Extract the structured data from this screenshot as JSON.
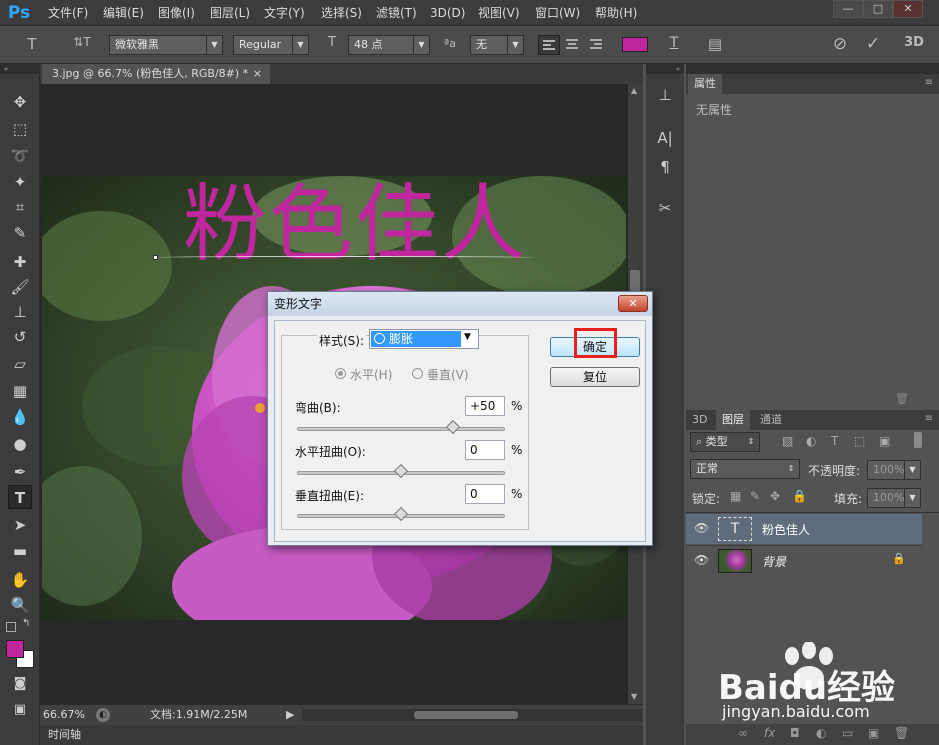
{
  "app": {
    "logo": "Ps",
    "accent": "#31a8ff"
  },
  "menu": [
    "文件(F)",
    "编辑(E)",
    "图像(I)",
    "图层(L)",
    "文字(Y)",
    "选择(S)",
    "滤镜(T)",
    "3D(D)",
    "视图(V)",
    "窗口(W)",
    "帮助(H)"
  ],
  "window_buttons": {
    "minimize": "—",
    "maximize": "□",
    "close": "✕"
  },
  "options": {
    "font_family": "微软雅黑",
    "font_style": "Regular",
    "font_size": "48 点",
    "antialias_label": "ªa",
    "antialias": "无",
    "text_color": "#c0279e",
    "icons": {
      "tool": "T",
      "orient": "⇅T",
      "size": "T",
      "warp": "T",
      "panels": "▤",
      "cancel": "⊘",
      "commit": "✓",
      "threed": "3D"
    }
  },
  "document": {
    "tab": "3.jpg @ 66.7% (粉色佳人, RGB/8#) *",
    "tab_close": "×",
    "text_layer": "粉色佳人",
    "text_color": "#c0279e",
    "zoom": "66.67%",
    "doc_info": "文档:1.91M/2.25M"
  },
  "timeline": {
    "label": "时间轴"
  },
  "properties": {
    "tab": "属性",
    "content": "无属性"
  },
  "layers_panel": {
    "tabs": [
      "3D",
      "图层",
      "通道"
    ],
    "filter_label": "类型",
    "blend_mode": "正常",
    "opacity_label": "不透明度:",
    "opacity": "100%",
    "lock_label": "锁定:",
    "fill_label": "填充:",
    "fill": "100%",
    "layers": [
      {
        "name": "粉色佳人",
        "thumb": "T",
        "selected": true
      },
      {
        "name": "背景",
        "selected": false
      }
    ],
    "footer_icons": [
      "∞",
      "fx",
      "◘",
      "◐",
      "▭",
      "▣",
      "🗑"
    ]
  },
  "warp_dialog": {
    "title": "变形文字",
    "style_label": "样式(S):",
    "style_value": "膨胀",
    "horizontal_label": "水平(H)",
    "vertical_label": "垂直(V)",
    "bend_label": "弯曲(B):",
    "bend_value": "+50",
    "hdistort_label": "水平扭曲(O):",
    "hdistort_value": "0",
    "vdistort_label": "垂直扭曲(E):",
    "vdistort_value": "0",
    "percent": "%",
    "ok_label": "确定",
    "reset_label": "复位",
    "bend_level": 0.75,
    "hdistort_level": 0.5,
    "vdistort_level": 0.5
  },
  "watermark": {
    "text": "Baidu经验",
    "url": "jingyan.baidu.com"
  }
}
